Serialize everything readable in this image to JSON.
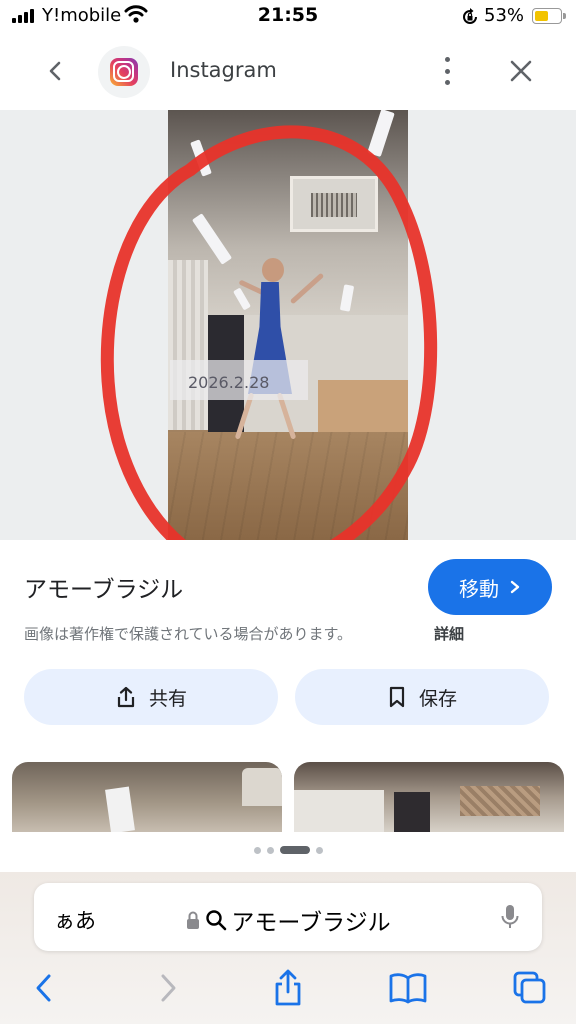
{
  "status_bar": {
    "carrier": "Y!mobile",
    "time": "21:55",
    "battery_percent": "53%",
    "battery_level": 0.53
  },
  "header": {
    "title": "Instagram"
  },
  "image": {
    "date_stamp": "2026.2.28"
  },
  "result": {
    "title": "アモーブラジル",
    "visit_label": "移動",
    "copyright_notice": "画像は著作権で保護されている場合があります。",
    "details_link": "詳細",
    "share_label": "共有",
    "save_label": "保存"
  },
  "pagination": {
    "count": 4,
    "active_index": 2
  },
  "safari": {
    "text_size_button": "ぁあ",
    "address_text": "アモーブラジル"
  },
  "colors": {
    "accent_blue": "#1a73e8",
    "action_button_bg": "#e8f0fe",
    "annotation_red": "#e8332a"
  }
}
